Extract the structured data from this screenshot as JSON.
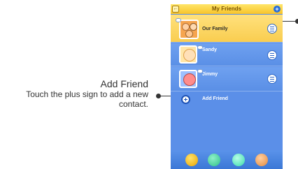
{
  "screen": {
    "title": "My Friends",
    "back_icon": "back-icon",
    "top_right_icon": "plus-icon"
  },
  "contacts": [
    {
      "name": "Our Family",
      "status": ""
    },
    {
      "name": "Sandy",
      "status": ""
    },
    {
      "name": "Jimmy",
      "status": ""
    }
  ],
  "add_friend_row": {
    "label": "Add Friend"
  },
  "bottom_nav": [
    {
      "icon": "friends-icon"
    },
    {
      "icon": "chat-icon"
    },
    {
      "icon": "music-icon"
    },
    {
      "icon": "lodge-icon"
    }
  ],
  "callout": {
    "title": "Add Friend",
    "description": "Touch the plus sign to add a new contact."
  },
  "colors": {
    "screen_bg": "#5b8fe8",
    "header_yellow": "#f8c42a",
    "accent_blue": "#2e67c6"
  }
}
